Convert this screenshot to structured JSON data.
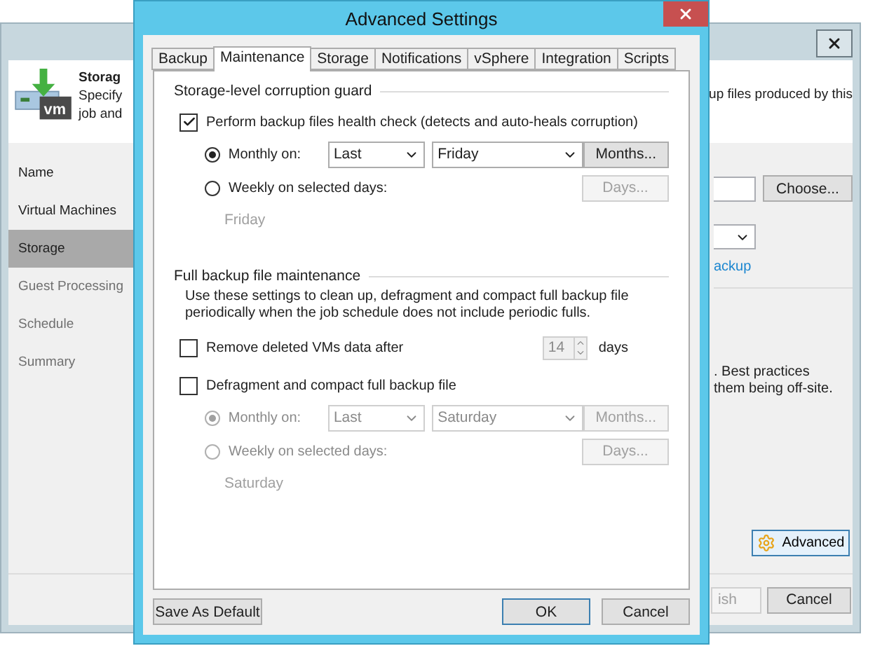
{
  "wizard": {
    "header": {
      "title": "Storag",
      "lines": [
        "Specify",
        "job and"
      ],
      "icon_label": "vm",
      "right_text": "up files produced by this"
    },
    "nav": [
      {
        "label": "Name",
        "selected": false,
        "disabled": false
      },
      {
        "label": "Virtual Machines",
        "selected": false,
        "disabled": false
      },
      {
        "label": "Storage",
        "selected": true,
        "disabled": false
      },
      {
        "label": "Guest Processing",
        "selected": false,
        "disabled": true
      },
      {
        "label": "Schedule",
        "selected": false,
        "disabled": true
      },
      {
        "label": "Summary",
        "selected": false,
        "disabled": true
      }
    ],
    "content": {
      "choose_button": "Choose...",
      "link": "ackup",
      "notes": [
        ". Best practices",
        "them being off-site."
      ],
      "advanced_button": "Advanced"
    },
    "footer": [
      {
        "label": "ish",
        "disabled": true
      },
      {
        "label": "Cancel",
        "disabled": false
      }
    ]
  },
  "dialog": {
    "title": "Advanced Settings",
    "tabs": [
      {
        "label": "Backup",
        "selected": false
      },
      {
        "label": "Maintenance",
        "selected": true
      },
      {
        "label": "Storage",
        "selected": false
      },
      {
        "label": "Notifications",
        "selected": false
      },
      {
        "label": "vSphere",
        "selected": false
      },
      {
        "label": "Integration",
        "selected": false
      },
      {
        "label": "Scripts",
        "selected": false
      }
    ],
    "corruption_guard": {
      "title": "Storage-level corruption guard",
      "health_check": {
        "label": "Perform backup files health check (detects and auto-heals corruption)",
        "checked": true
      },
      "schedule": {
        "monthly": {
          "label": "Monthly on:",
          "selected": true,
          "week": "Last",
          "day": "Friday",
          "button": "Months..."
        },
        "weekly": {
          "label": "Weekly on selected days:",
          "selected": false,
          "button": "Days...",
          "days": "Friday"
        }
      }
    },
    "full_maintenance": {
      "title": "Full backup file maintenance",
      "description": "Use these settings to clean up, defragment and compact full backup file periodically when the job schedule does not include periodic fulls.",
      "remove_vms": {
        "label": "Remove deleted VMs data after",
        "checked": false,
        "value": "14",
        "unit": "days"
      },
      "defragment": {
        "label": "Defragment and compact full backup file",
        "checked": false
      },
      "schedule": {
        "monthly": {
          "label": "Monthly on:",
          "selected": true,
          "week": "Last",
          "day": "Saturday",
          "button": "Months..."
        },
        "weekly": {
          "label": "Weekly on selected days:",
          "selected": false,
          "button": "Days...",
          "days": "Saturday"
        }
      }
    },
    "footer": {
      "save_default": "Save As Default",
      "ok": "OK",
      "cancel": "Cancel"
    }
  }
}
